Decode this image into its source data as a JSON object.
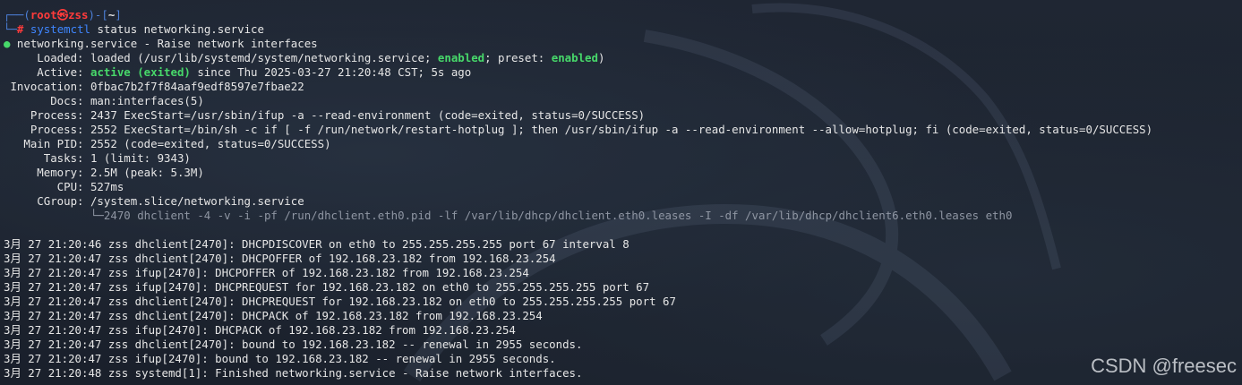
{
  "prompt": {
    "line1_prefix": "┌──(",
    "user": "root",
    "at_symbol": "㉿",
    "host": "zss",
    "line1_mid": ")-[",
    "cwd": "~",
    "line1_end": "]",
    "line2_prefix": "└─",
    "hash": "#",
    "cmd_name": "systemctl",
    "cmd_args": " status networking.service"
  },
  "service": {
    "bullet": "●",
    "header": " networking.service - Raise network interfaces",
    "loaded_label": "     Loaded: ",
    "loaded_a": "loaded (/usr/lib/systemd/system/networking.service; ",
    "loaded_enabled": "enabled",
    "loaded_b": "; preset: ",
    "loaded_preset": "enabled",
    "loaded_c": ")",
    "active_label": "     Active: ",
    "active_state": "active (exited)",
    "active_rest": " since Thu 2025-03-27 21:20:48 CST; 5s ago",
    "invocation": " Invocation: 0fbac7b2f7f84aaf9edf8597e7fbae22",
    "docs": "       Docs: man:interfaces(5)",
    "process1": "    Process: 2437 ExecStart=/usr/sbin/ifup -a --read-environment (code=exited, status=0/SUCCESS)",
    "process2": "    Process: 2552 ExecStart=/bin/sh -c if [ -f /run/network/restart-hotplug ]; then /usr/sbin/ifup -a --read-environment --allow=hotplug; fi (code=exited, status=0/SUCCESS)",
    "mainpid": "   Main PID: 2552 (code=exited, status=0/SUCCESS)",
    "tasks": "      Tasks: 1 (limit: 9343)",
    "memory": "     Memory: 2.5M (peak: 5.3M)",
    "cpu": "        CPU: 527ms",
    "cgroup": "     CGroup: /system.slice/networking.service",
    "cgroup_child_prefix": "             └─",
    "cgroup_child": "2470 dhclient -4 -v -i -pf /run/dhclient.eth0.pid -lf /var/lib/dhcp/dhclient.eth0.leases -I -df /var/lib/dhcp/dhclient6.eth0.leases eth0"
  },
  "log": [
    "3月 27 21:20:46 zss dhclient[2470]: DHCPDISCOVER on eth0 to 255.255.255.255 port 67 interval 8",
    "3月 27 21:20:47 zss dhclient[2470]: DHCPOFFER of 192.168.23.182 from 192.168.23.254",
    "3月 27 21:20:47 zss ifup[2470]: DHCPOFFER of 192.168.23.182 from 192.168.23.254",
    "3月 27 21:20:47 zss ifup[2470]: DHCPREQUEST for 192.168.23.182 on eth0 to 255.255.255.255 port 67",
    "3月 27 21:20:47 zss dhclient[2470]: DHCPREQUEST for 192.168.23.182 on eth0 to 255.255.255.255 port 67",
    "3月 27 21:20:47 zss dhclient[2470]: DHCPACK of 192.168.23.182 from 192.168.23.254",
    "3月 27 21:20:47 zss ifup[2470]: DHCPACK of 192.168.23.182 from 192.168.23.254",
    "3月 27 21:20:47 zss dhclient[2470]: bound to 192.168.23.182 -- renewal in 2955 seconds.",
    "3月 27 21:20:47 zss ifup[2470]: bound to 192.168.23.182 -- renewal in 2955 seconds.",
    "3月 27 21:20:48 zss systemd[1]: Finished networking.service - Raise network interfaces."
  ],
  "watermark": "CSDN @freesec",
  "colors": {
    "background": "#1d2330",
    "prompt_blue": "#4c7fd8",
    "user_red": "#ff3b3b",
    "enabled_green": "#47d86a",
    "text": "#e6e6e6",
    "dim": "#8f96a3"
  }
}
